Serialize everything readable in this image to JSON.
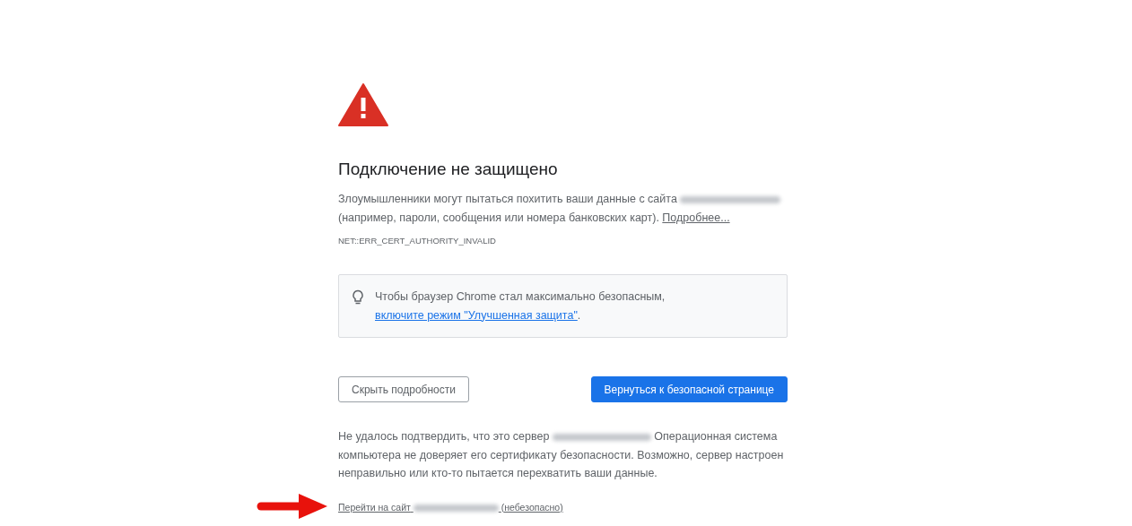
{
  "heading": "Подключение не защищено",
  "intro": {
    "text_before": "Злоумышленники могут пытаться похитить ваши данные с сайта",
    "text_after": "(например, пароли, сообщения или номера банковских карт).",
    "link": "Подробнее..."
  },
  "error_code": "NET::ERR_CERT_AUTHORITY_INVALID",
  "tip": {
    "text": "Чтобы браузер Chrome стал максимально безопасным,",
    "link": "включите режим \"Улучшенная защита\"",
    "text_after": "."
  },
  "buttons": [
    {
      "label": "Скрыть подробности",
      "kind": "secondary"
    },
    {
      "label": "Вернуться к безопасной странице",
      "kind": "primary"
    }
  ],
  "details": {
    "text_before": "Не удалось подтвердить, что это сервер",
    "text_after": "Операционная система",
    "continuation": "компьютера не доверяет его сертификату безопасности. Возможно, сервер настроен неправильно или кто-то пытается перехватить ваши данные."
  },
  "proceed_link": {
    "text_before": "Перейти на сайт",
    "text_after": "(небезопасно)"
  }
}
